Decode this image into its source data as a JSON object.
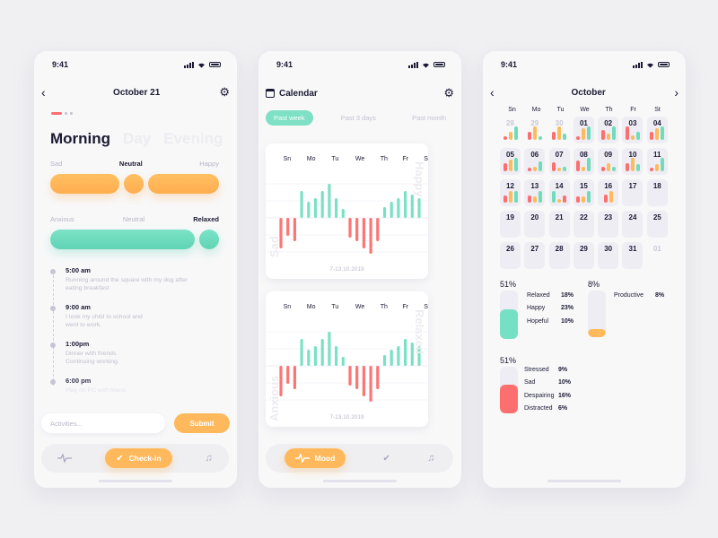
{
  "status_time": "9:41",
  "colors": {
    "orange": "#ffb95c",
    "green": "#6fdcbc",
    "red": "#fd6f6f",
    "dark": "#1b1a33",
    "muted": "#c3c2d2"
  },
  "screen1": {
    "title": "October 21",
    "back_icon": "chevron-left-icon",
    "settings_icon": "gear-icon",
    "periods": [
      "Morning",
      "Day",
      "Evening"
    ],
    "active_period": "Morning",
    "mood_scale": {
      "labels": [
        "Sad",
        "Neutral",
        "Happy"
      ],
      "selected": "Neutral"
    },
    "anxiety_scale": {
      "labels": [
        "Anxious",
        "Neutral",
        "Relaxed"
      ],
      "selected": "Relaxed"
    },
    "timeline": [
      {
        "time": "5:00 am",
        "desc": "Running around the square with my dog after eating breakfast"
      },
      {
        "time": "9:00 am",
        "desc": "I took my child to school and went to work."
      },
      {
        "time": "1:00pm",
        "desc": "Dinner with friends. Continuing working."
      },
      {
        "time": "6:00 pm",
        "desc": "Play on PC with friend"
      }
    ],
    "activities_placeholder": "Activities...",
    "submit_label": "Submit",
    "nav": {
      "mood_icon": "pulse-icon",
      "checkin_label": "Check-in",
      "checkin_icon": "double-check-icon",
      "music_icon": "music-note-icon"
    }
  },
  "screen2": {
    "title": "Calendar",
    "calendar_icon": "calendar-icon",
    "settings_icon": "gear-icon",
    "tabs": [
      "Past week",
      "Past 3 days",
      "Past month"
    ],
    "active_tab": "Past week",
    "nav": {
      "mood_label": "Mood",
      "mood_icon": "pulse-icon",
      "checkin_icon": "double-check-icon",
      "music_icon": "music-note-icon"
    }
  },
  "chart_data": [
    {
      "type": "bar",
      "title": "",
      "categories": [
        "Sn",
        "Mo",
        "Tu",
        "We",
        "Th",
        "Fr",
        "St"
      ],
      "positive_label": "Happy",
      "negative_label": "Sad",
      "date_range": "7-13.10.2019",
      "values": [
        -8.5,
        -5,
        -6.5,
        7.5,
        4.5,
        5.5,
        7.5,
        9.5,
        5.5,
        2.5,
        -5.5,
        -6.5,
        -8.5,
        -10,
        -6.5,
        3,
        4.5,
        5.5,
        7.5,
        6.5,
        5.5
      ],
      "ylim": [
        -10,
        10
      ],
      "grid": true
    },
    {
      "type": "bar",
      "title": "",
      "categories": [
        "Sn",
        "Mo",
        "Tu",
        "We",
        "Th",
        "Fr",
        "St"
      ],
      "positive_label": "Relaxed",
      "negative_label": "Anxious",
      "date_range": "7-13.10.2019",
      "values": [
        -8.5,
        -5,
        -6.5,
        7.5,
        4.5,
        5.5,
        7.5,
        9.5,
        5.5,
        2.5,
        -5.5,
        -6.5,
        -8.5,
        -10,
        -6.5,
        3,
        4.5,
        5.5,
        7.5,
        6.5,
        5.5
      ],
      "ylim": [
        -10,
        10
      ],
      "grid": true
    }
  ],
  "screen3": {
    "month": "October",
    "prev_icon": "chevron-left-icon",
    "next_icon": "chevron-right-icon",
    "weekdays": [
      "Sn",
      "Mo",
      "Tu",
      "We",
      "Th",
      "Fr",
      "St"
    ],
    "days": [
      {
        "d": "28",
        "other": true,
        "bars": [
          0.3,
          0.6,
          1.0
        ]
      },
      {
        "d": "29",
        "other": true,
        "bars": [
          0.6,
          1.0,
          0.3
        ]
      },
      {
        "d": "30",
        "other": true,
        "bars": [
          0.6,
          1.0,
          0.5
        ]
      },
      {
        "d": "01",
        "other": false,
        "bars": [
          0.3,
          0.85,
          1.0
        ]
      },
      {
        "d": "02",
        "other": false,
        "bars": [
          0.75,
          0.5,
          1.0
        ]
      },
      {
        "d": "03",
        "other": false,
        "bars": [
          1.0,
          0.35,
          0.6
        ]
      },
      {
        "d": "04",
        "other": false,
        "bars": [
          0.6,
          0.85,
          1.0
        ]
      },
      {
        "d": "05",
        "other": false,
        "bars": [
          0.6,
          0.85,
          1.0
        ]
      },
      {
        "d": "06",
        "other": false,
        "bars": [
          0.25,
          0.35,
          0.75
        ]
      },
      {
        "d": "07",
        "other": false,
        "bars": [
          0.65,
          0.3,
          0.35
        ]
      },
      {
        "d": "08",
        "other": false,
        "bars": [
          0.8,
          0.35,
          1.0
        ]
      },
      {
        "d": "09",
        "other": false,
        "bars": [
          0.35,
          0.6,
          0.35
        ]
      },
      {
        "d": "10",
        "other": false,
        "bars": [
          0.6,
          1.0,
          0.55
        ]
      },
      {
        "d": "11",
        "other": false,
        "bars": [
          0.25,
          0.55,
          1.0
        ]
      },
      {
        "d": "12",
        "other": false,
        "bars": [
          0.55,
          0.85,
          0.9
        ]
      },
      {
        "d": "13",
        "other": false,
        "bars": [
          0.55,
          0.5,
          0.85
        ]
      },
      {
        "d": "14",
        "other": false,
        "bars": [
          0.85,
          0.3,
          0.55
        ],
        "order": [
          "g",
          "o",
          "r"
        ]
      },
      {
        "d": "15",
        "other": false,
        "bars": [
          0.5,
          0.45,
          0.9
        ]
      },
      {
        "d": "16",
        "other": false,
        "bars": [
          0.6,
          0.85
        ]
      },
      {
        "d": "17",
        "other": false,
        "bars": []
      },
      {
        "d": "18",
        "other": false,
        "bars": []
      },
      {
        "d": "19",
        "other": false,
        "bars": []
      },
      {
        "d": "20",
        "other": false,
        "bars": []
      },
      {
        "d": "21",
        "other": false,
        "bars": []
      },
      {
        "d": "22",
        "other": false,
        "bars": []
      },
      {
        "d": "23",
        "other": false,
        "bars": []
      },
      {
        "d": "24",
        "other": false,
        "bars": []
      },
      {
        "d": "25",
        "other": false,
        "bars": []
      },
      {
        "d": "26",
        "other": false,
        "bars": []
      },
      {
        "d": "27",
        "other": false,
        "bars": []
      },
      {
        "d": "28",
        "other": false,
        "bars": []
      },
      {
        "d": "29",
        "other": false,
        "bars": []
      },
      {
        "d": "30",
        "other": false,
        "bars": []
      },
      {
        "d": "31",
        "other": false,
        "bars": []
      },
      {
        "d": "01",
        "other": true,
        "bars": []
      }
    ],
    "stats": {
      "positive": {
        "total": "51%",
        "fill": 0.51,
        "items": [
          {
            "name": "Relaxed",
            "value": "18%"
          },
          {
            "name": "Happy",
            "value": "23%"
          },
          {
            "name": "Hopeful",
            "value": "10%"
          }
        ]
      },
      "productive": {
        "total": "8%",
        "fill": 0.08,
        "items": [
          {
            "name": "Productive",
            "value": "8%"
          }
        ]
      },
      "negative": {
        "total": "51%",
        "fill": 0.51,
        "items": [
          {
            "name": "Stressed",
            "value": "9%"
          },
          {
            "name": "Sad",
            "value": "10%"
          },
          {
            "name": "Despairing",
            "value": "16%"
          },
          {
            "name": "Distracted",
            "value": "6%"
          }
        ]
      }
    }
  }
}
